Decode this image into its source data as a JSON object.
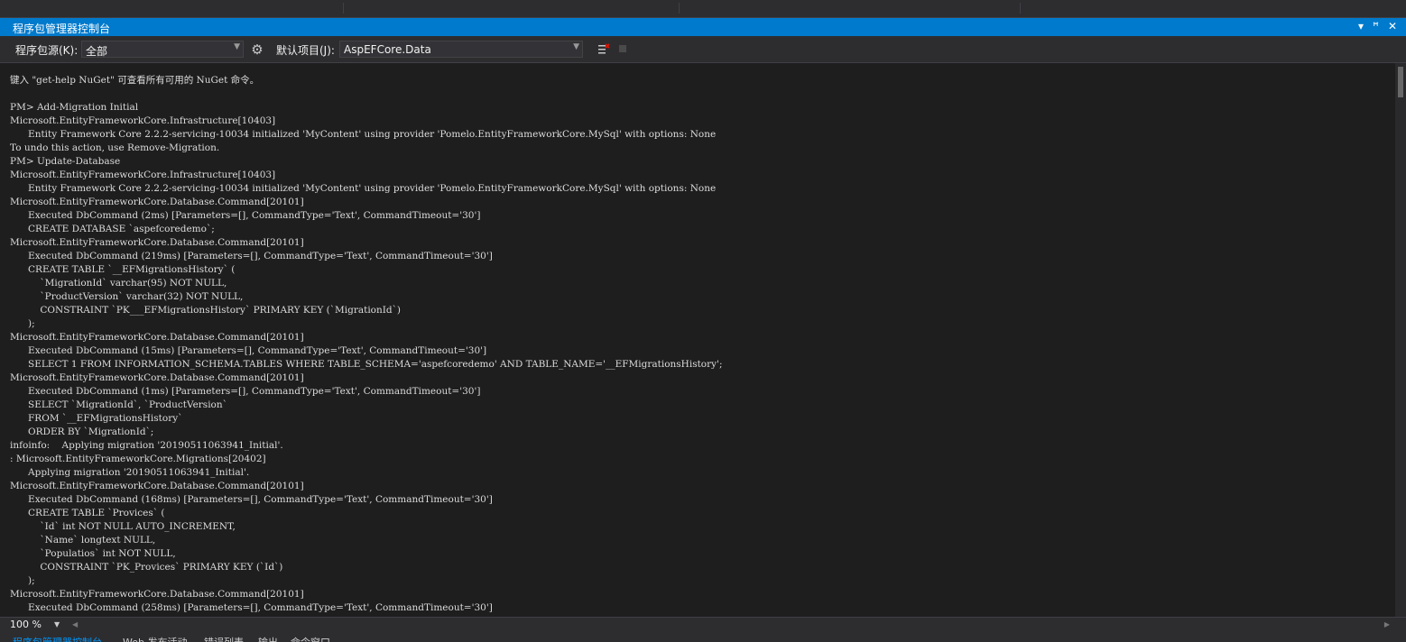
{
  "window": {
    "title": "程序包管理器控制台",
    "controls": [
      "▾",
      "ꟸ",
      "✕"
    ]
  },
  "toolbar": {
    "source_label": "程序包源(K):",
    "source_value": "全部",
    "project_label": "默认项目(J):",
    "project_value": "AspEFCore.Data"
  },
  "console": {
    "lines": [
      "键入 \"get-help NuGet\" 可查看所有可用的 NuGet 命令。",
      "",
      "PM> Add-Migration Initial",
      "Microsoft.EntityFrameworkCore.Infrastructure[10403]",
      "      Entity Framework Core 2.2.2-servicing-10034 initialized 'MyContent' using provider 'Pomelo.EntityFrameworkCore.MySql' with options: None",
      "To undo this action, use Remove-Migration.",
      "PM> Update-Database",
      "Microsoft.EntityFrameworkCore.Infrastructure[10403]",
      "      Entity Framework Core 2.2.2-servicing-10034 initialized 'MyContent' using provider 'Pomelo.EntityFrameworkCore.MySql' with options: None",
      "Microsoft.EntityFrameworkCore.Database.Command[20101]",
      "      Executed DbCommand (2ms) [Parameters=[], CommandType='Text', CommandTimeout='30']",
      "      CREATE DATABASE `aspefcoredemo`;",
      "Microsoft.EntityFrameworkCore.Database.Command[20101]",
      "      Executed DbCommand (219ms) [Parameters=[], CommandType='Text', CommandTimeout='30']",
      "      CREATE TABLE `__EFMigrationsHistory` (",
      "          `MigrationId` varchar(95) NOT NULL,",
      "          `ProductVersion` varchar(32) NOT NULL,",
      "          CONSTRAINT `PK___EFMigrationsHistory` PRIMARY KEY (`MigrationId`)",
      "      );",
      "Microsoft.EntityFrameworkCore.Database.Command[20101]",
      "      Executed DbCommand (15ms) [Parameters=[], CommandType='Text', CommandTimeout='30']",
      "      SELECT 1 FROM INFORMATION_SCHEMA.TABLES WHERE TABLE_SCHEMA='aspefcoredemo' AND TABLE_NAME='__EFMigrationsHistory';",
      "Microsoft.EntityFrameworkCore.Database.Command[20101]",
      "      Executed DbCommand (1ms) [Parameters=[], CommandType='Text', CommandTimeout='30']",
      "      SELECT `MigrationId`, `ProductVersion`",
      "      FROM `__EFMigrationsHistory`",
      "      ORDER BY `MigrationId`;",
      "infoinfo:    Applying migration '20190511063941_Initial'.",
      ": Microsoft.EntityFrameworkCore.Migrations[20402]",
      "      Applying migration '20190511063941_Initial'.",
      "Microsoft.EntityFrameworkCore.Database.Command[20101]",
      "      Executed DbCommand (168ms) [Parameters=[], CommandType='Text', CommandTimeout='30']",
      "      CREATE TABLE `Provices` (",
      "          `Id` int NOT NULL AUTO_INCREMENT,",
      "          `Name` longtext NULL,",
      "          `Populatios` int NOT NULL,",
      "          CONSTRAINT `PK_Provices` PRIMARY KEY (`Id`)",
      "      );",
      "Microsoft.EntityFrameworkCore.Database.Command[20101]",
      "      Executed DbCommand (258ms) [Parameters=[], CommandType='Text', CommandTimeout='30']"
    ]
  },
  "statusbar": {
    "zoom": "100 %"
  },
  "tabs": [
    {
      "label": "程序包管理器控制台",
      "active": true
    },
    {
      "label": "Web 发布活动",
      "active": false
    },
    {
      "label": "错误列表",
      "active": false
    },
    {
      "label": "输出",
      "active": false
    },
    {
      "label": "命令窗口",
      "active": false
    }
  ],
  "colors": {
    "accent": "#007acc",
    "background": "#1e1e1e",
    "toolbar": "#2d2d30",
    "text": "#dcdcdc"
  }
}
